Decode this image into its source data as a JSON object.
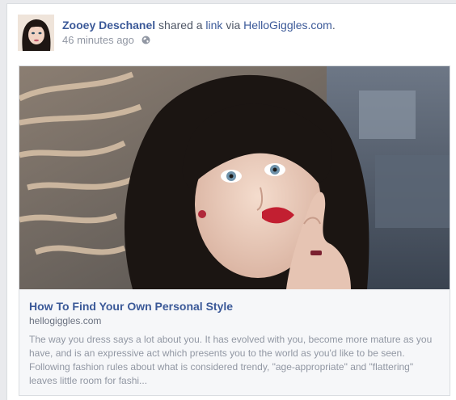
{
  "post": {
    "author": "Zooey Deschanel",
    "action_text": " shared a ",
    "action_link": "link",
    "via_text": " via ",
    "via_link": "HelloGiggles.com",
    "punct": ".",
    "timestamp": "46 minutes ago",
    "privacy_icon": "globe-icon"
  },
  "attachment": {
    "image_icon": "photo-zooey-deschanel",
    "title": "How To Find Your Own Personal Style",
    "domain": "hellogiggles.com",
    "description": "The way you dress says a lot about you. It has evolved with you, become more mature as you have, and is an expressive act which presents you to the world as you'd like to be seen. Following fashion rules about what is considered trendy, \"age-appropriate\" and \"flattering\" leaves little room for fashi..."
  },
  "colors": {
    "link_blue": "#3b5998",
    "meta_gray": "#9197a3",
    "body_gray": "#4e5665"
  }
}
